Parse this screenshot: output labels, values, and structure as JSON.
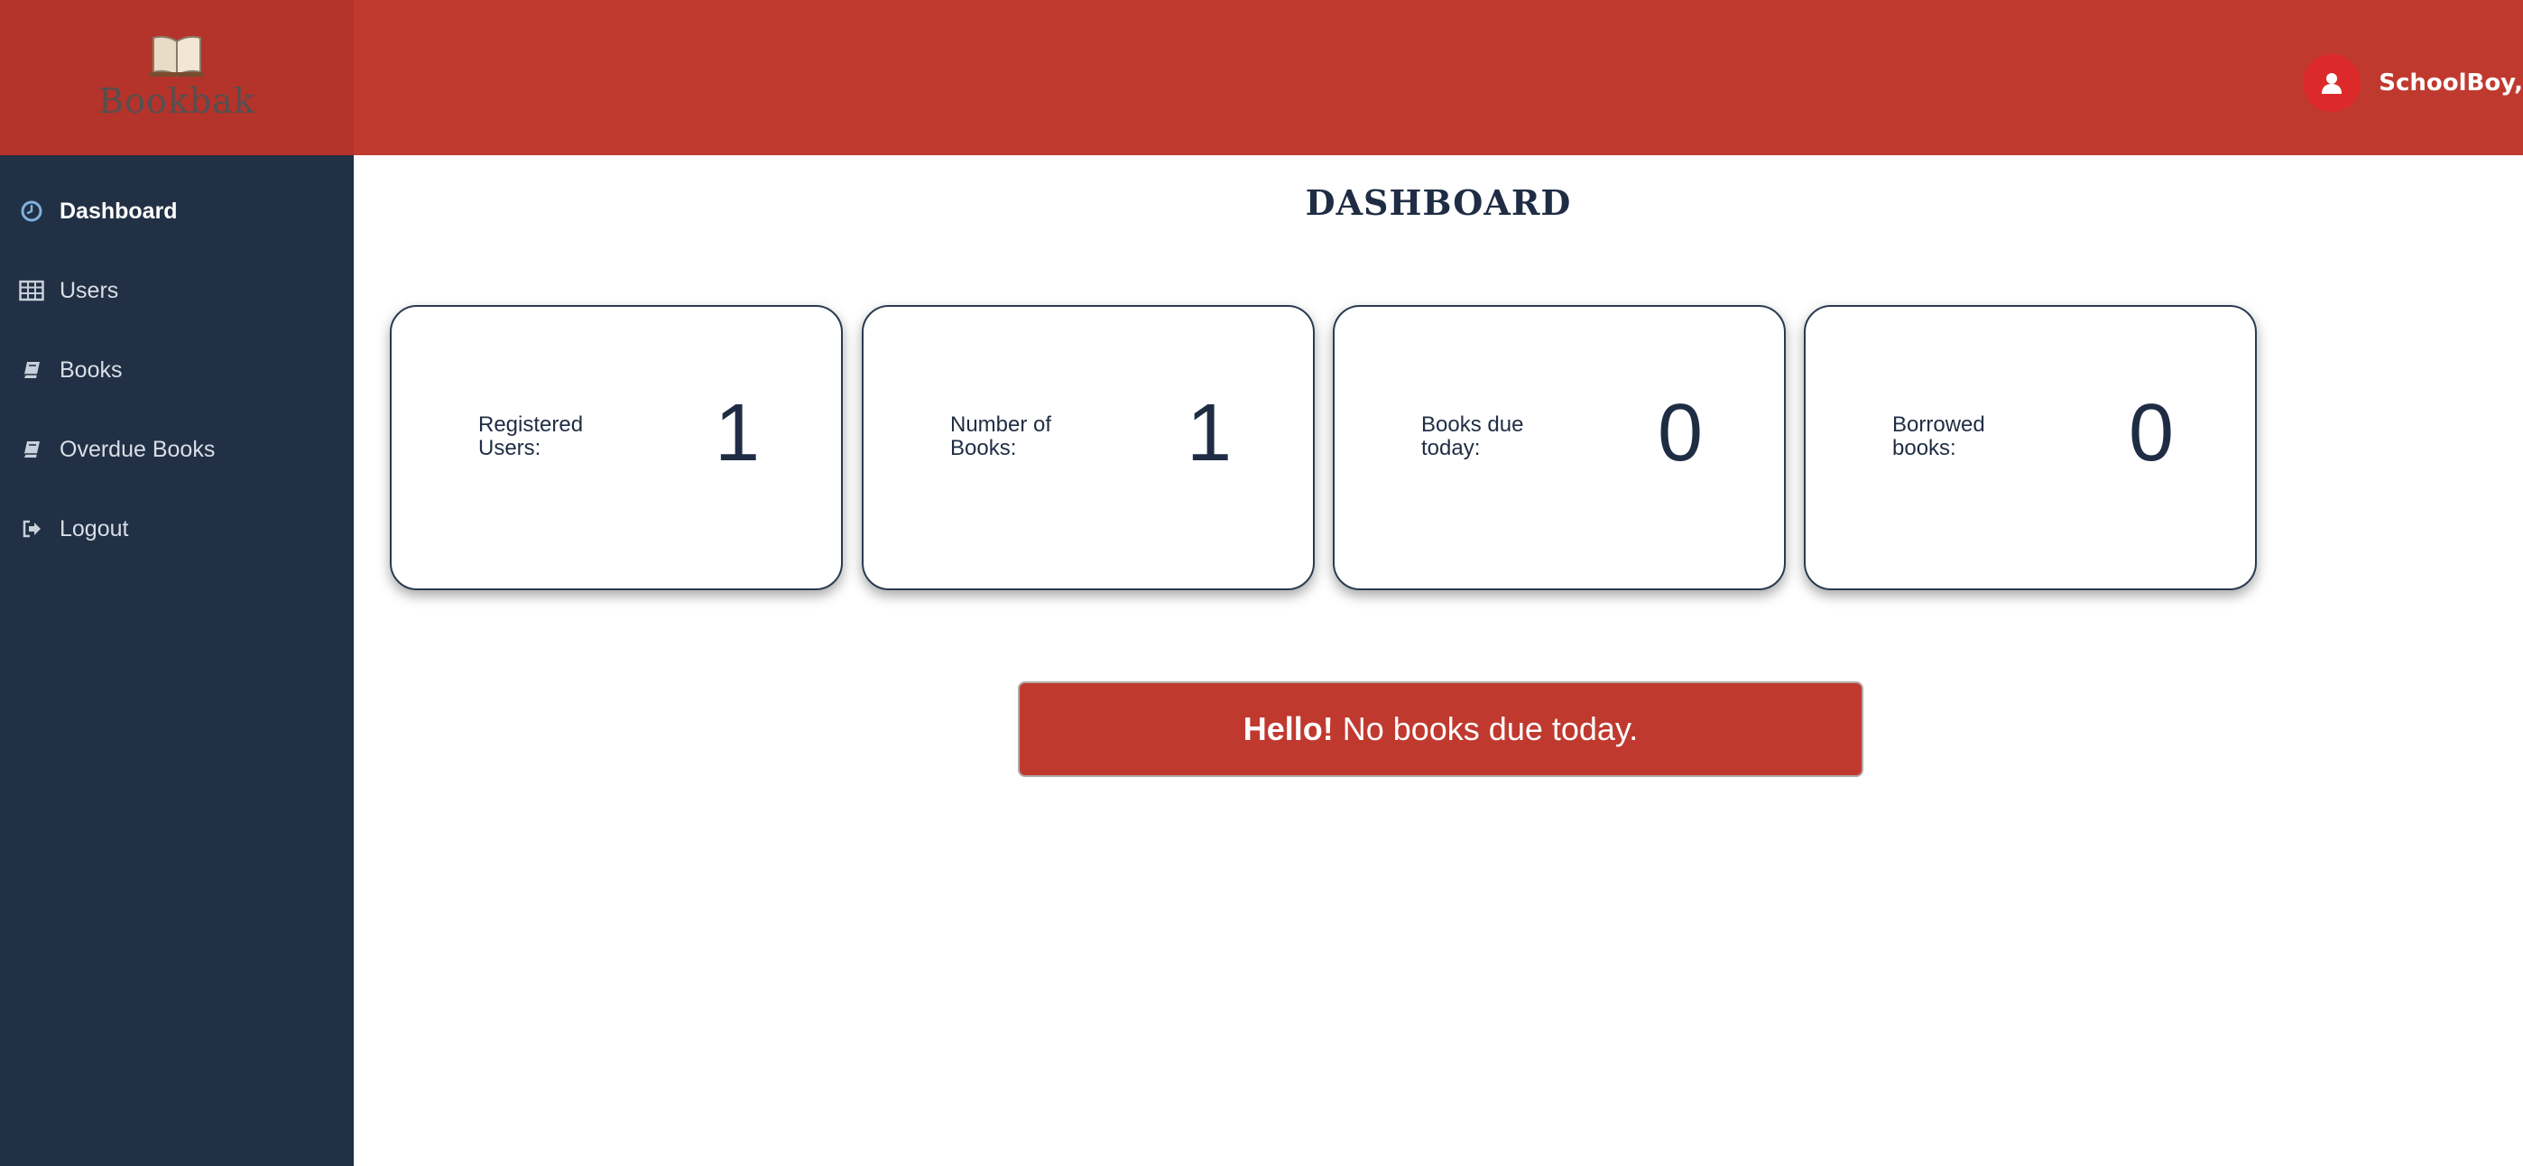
{
  "brand": {
    "name": "Bookbak"
  },
  "user": {
    "name": "SchoolBoy,"
  },
  "sidebar": {
    "items": [
      {
        "label": "Dashboard",
        "icon": "clock-icon"
      },
      {
        "label": "Users",
        "icon": "table-icon"
      },
      {
        "label": "Books",
        "icon": "book-icon"
      },
      {
        "label": "Overdue Books",
        "icon": "book-icon"
      },
      {
        "label": "Logout",
        "icon": "sign-out-icon"
      }
    ]
  },
  "main": {
    "title": "DASHBOARD",
    "cards": [
      {
        "label": "Registered Users:",
        "value": "1"
      },
      {
        "label": "Number of Books:",
        "value": "1"
      },
      {
        "label": "Books due today:",
        "value": "0"
      },
      {
        "label": "Borrowed books:",
        "value": "0"
      }
    ],
    "alert": {
      "strong": "Hello!",
      "text": "No books due today."
    }
  },
  "colors": {
    "header": "#c0392f",
    "logo_bg": "#b4332a",
    "sidebar": "#213045",
    "text_dark": "#1f2d44"
  }
}
